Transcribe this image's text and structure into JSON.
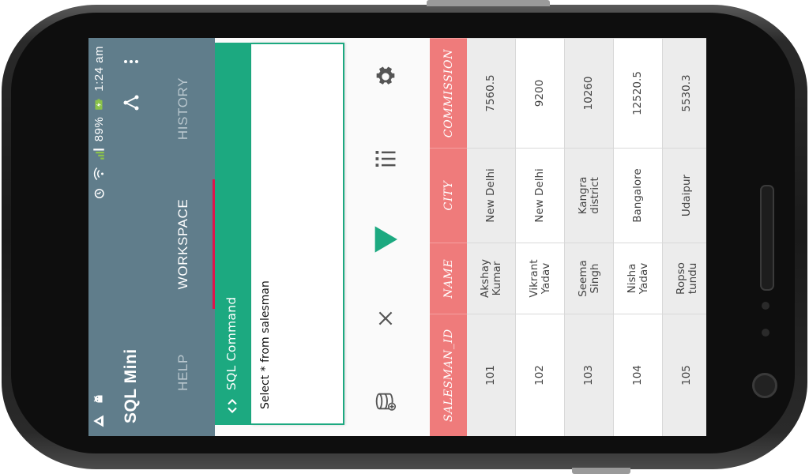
{
  "status_bar": {
    "time": "1:24 am",
    "battery_percent": "89%",
    "left_icons": [
      "warning-triangle-icon",
      "android-debug-icon"
    ],
    "right_icons": [
      "alarm-icon",
      "wifi-icon",
      "signal-icon",
      "battery-charging-icon"
    ]
  },
  "app": {
    "title": "SQL Mini",
    "actions": [
      "share-icon",
      "more-vert-icon"
    ]
  },
  "tabs": [
    {
      "label": "HELP",
      "active": false
    },
    {
      "label": "WORKSPACE",
      "active": true
    },
    {
      "label": "HISTORY",
      "active": false
    }
  ],
  "command": {
    "header_label": "SQL Command",
    "icon": "code-brackets-icon",
    "query": "Select * from salesman"
  },
  "toolbar": {
    "icons": [
      "database-add-icon",
      "clear-x-icon",
      "run-triangle-icon",
      "columns-icon",
      "settings-gear-icon"
    ]
  },
  "results": {
    "headers": [
      "SALESMAN_ID",
      "NAME",
      "CITY",
      "COMMISSION"
    ],
    "rows": [
      [
        "101",
        "Akshay\nKumar",
        "New Delhi",
        "7560.5"
      ],
      [
        "102",
        "Vikrant\nYadav",
        "New Delhi",
        "9200"
      ],
      [
        "103",
        "Seema\nSingh",
        "Kangra\ndistrict",
        "10260"
      ],
      [
        "104",
        "Nisha\nYadav",
        "Bangalore",
        "12520.5"
      ],
      [
        "105",
        "Ropso\ntundu",
        "Udaipur",
        "5530.3"
      ]
    ]
  },
  "colors": {
    "app_bar": "#607d8b",
    "tab_indicator": "#e0144c",
    "accent_green": "#1ca980",
    "table_header": "#ef7b7b"
  }
}
